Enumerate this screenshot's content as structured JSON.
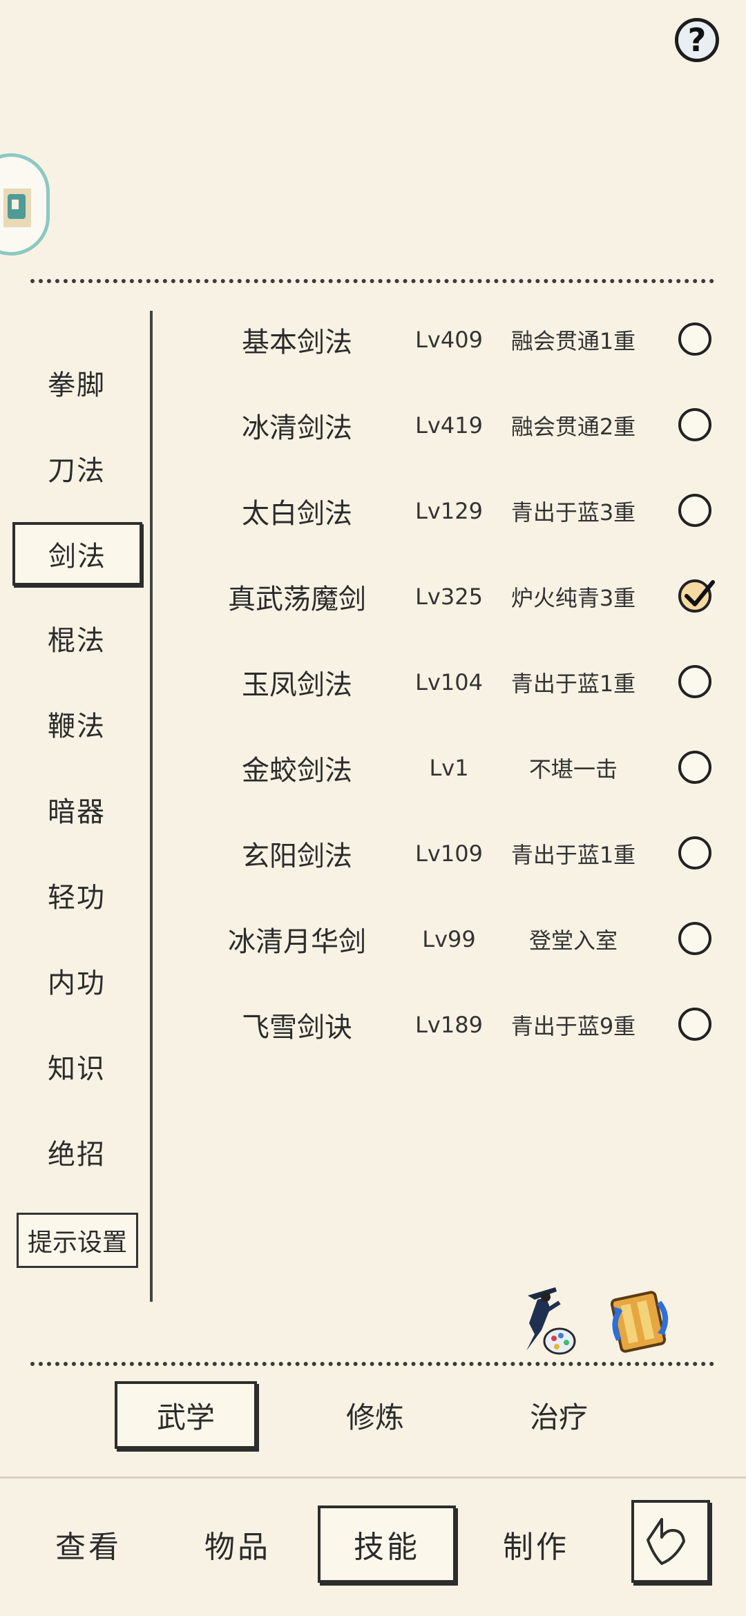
{
  "help": {
    "glyph": "?"
  },
  "categories": [
    {
      "label": "拳脚",
      "active": false
    },
    {
      "label": "刀法",
      "active": false
    },
    {
      "label": "剑法",
      "active": true
    },
    {
      "label": "棍法",
      "active": false
    },
    {
      "label": "鞭法",
      "active": false
    },
    {
      "label": "暗器",
      "active": false
    },
    {
      "label": "轻功",
      "active": false
    },
    {
      "label": "内功",
      "active": false
    },
    {
      "label": "知识",
      "active": false
    },
    {
      "label": "绝招",
      "active": false
    }
  ],
  "tip_setting_label": "提示设置",
  "skills": [
    {
      "name": "基本剑法",
      "level": "Lv409",
      "rank": "融会贯通1重",
      "selected": false
    },
    {
      "name": "冰清剑法",
      "level": "Lv419",
      "rank": "融会贯通2重",
      "selected": false
    },
    {
      "name": "太白剑法",
      "level": "Lv129",
      "rank": "青出于蓝3重",
      "selected": false
    },
    {
      "name": "真武荡魔剑",
      "level": "Lv325",
      "rank": "炉火纯青3重",
      "selected": true
    },
    {
      "name": "玉凤剑法",
      "level": "Lv104",
      "rank": "青出于蓝1重",
      "selected": false
    },
    {
      "name": "金蛟剑法",
      "level": "Lv1",
      "rank": "不堪一击",
      "selected": false
    },
    {
      "name": "玄阳剑法",
      "level": "Lv109",
      "rank": "青出于蓝1重",
      "selected": false
    },
    {
      "name": "冰清月华剑",
      "level": "Lv99",
      "rank": "登堂入室",
      "selected": false
    },
    {
      "name": "飞雪剑诀",
      "level": "Lv189",
      "rank": "青出于蓝9重",
      "selected": false
    }
  ],
  "subtabs": [
    {
      "label": "武学",
      "active": true
    },
    {
      "label": "修炼",
      "active": false
    },
    {
      "label": "治疗",
      "active": false
    }
  ],
  "nav": [
    {
      "label": "查看",
      "active": false
    },
    {
      "label": "物品",
      "active": false
    },
    {
      "label": "技能",
      "active": true
    },
    {
      "label": "制作",
      "active": false
    }
  ],
  "icons": {
    "help": "help-icon",
    "avatar": "avatar-icon",
    "skill_art": "swordsman-palette-icon",
    "swap": "scroll-swap-icon",
    "back": "back-arrow-icon"
  },
  "colors": {
    "background": "#f8f2e4",
    "checked_radio": "#f6d9a3",
    "avatar_ring": "#8bc9c2"
  }
}
